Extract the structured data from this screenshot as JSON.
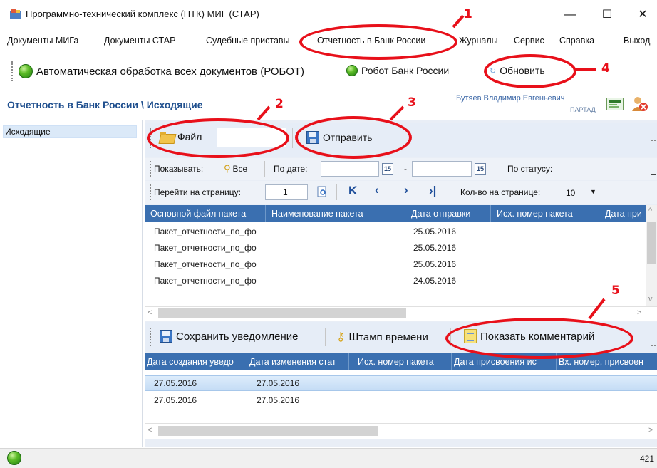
{
  "window": {
    "title": "Программно-технический комплекс (ПТК) МИГ (СТАР)",
    "minimize": "—",
    "maximize": "☐",
    "close": "✕"
  },
  "menu": {
    "items": [
      "Документы МИГа",
      "Документы СТАР",
      "Судебные приставы",
      "Отчетность в Банк России",
      "Журналы",
      "Сервис",
      "Справка",
      "Выход"
    ]
  },
  "toolbar": {
    "auto_processing": "Автоматическая обработка всех документов (РОБОТ)",
    "bank_robot": "Робот Банк России",
    "refresh": "Обновить"
  },
  "breadcrumb": "Отчетность в Банк России \\ Исходящие",
  "user": {
    "name": "Бутяев Владимир Евгеньевич",
    "org": "ПАРТАД"
  },
  "tree": {
    "items": [
      "Исходящие"
    ]
  },
  "actions": {
    "file": "Файл",
    "send": "Отправить"
  },
  "filter": {
    "show_label": "Показывать:",
    "all_label": "Все",
    "by_date_label": "По дате:",
    "date_sep": "-",
    "by_status_label": "По статусу:",
    "cal_glyph": "15"
  },
  "pager": {
    "goto_label": "Перейти на страницу:",
    "page_value": "1",
    "per_page_label": "Кол-во на странице:",
    "per_page_value": "10"
  },
  "grid1": {
    "columns": [
      "Основной файл пакета",
      "Наименование пакета",
      "Дата отправки",
      "Исх. номер пакета",
      "Дата при"
    ],
    "rows": [
      {
        "file": "Пакет_отчетности_по_фо",
        "date": "25.05.2016"
      },
      {
        "file": "Пакет_отчетности_по_фо",
        "date": "25.05.2016"
      },
      {
        "file": "Пакет_отчетности_по_фо",
        "date": "25.05.2016"
      },
      {
        "file": "Пакет_отчетности_по_фо",
        "date": "24.05.2016"
      }
    ]
  },
  "notices": {
    "save": "Сохранить уведомление",
    "timestamp": "Штамп времени",
    "show_comment": "Показать комментарий"
  },
  "grid2": {
    "columns": [
      "Дата создания уведо",
      "Дата изменения стат",
      "Исх. номер пакета",
      "Дата присвоения ис",
      "Вх. номер, присвоен"
    ],
    "rows": [
      {
        "created": "27.05.2016",
        "changed": "27.05.2016"
      },
      {
        "created": "27.05.2016",
        "changed": "27.05.2016"
      }
    ]
  },
  "status": {
    "right_text": "421"
  },
  "annotations": [
    "1",
    "2",
    "3",
    "4",
    "5"
  ],
  "colors": {
    "accent_red": "#e8101a",
    "grid_header": "#3a6fb0",
    "breadcrumb": "#1f4f8e"
  }
}
